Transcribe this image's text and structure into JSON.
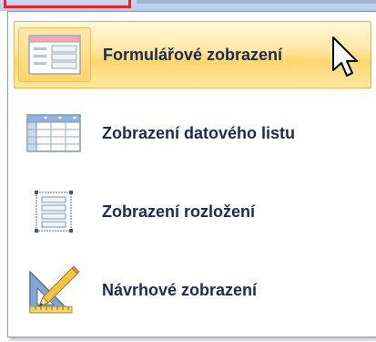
{
  "menu": {
    "items": [
      {
        "label": "Formulářové zobrazení",
        "icon": "form-view-icon",
        "highlighted": true
      },
      {
        "label": "Zobrazení datového listu",
        "icon": "datasheet-view-icon",
        "highlighted": false
      },
      {
        "label": "Zobrazení rozložení",
        "icon": "layout-view-icon",
        "highlighted": false
      },
      {
        "label": "Návrhové zobrazení",
        "icon": "design-view-icon",
        "highlighted": false
      }
    ]
  },
  "colors": {
    "highlight": "#ffd66e",
    "label_text": "#1b2a56",
    "marker": "#e0262b"
  }
}
